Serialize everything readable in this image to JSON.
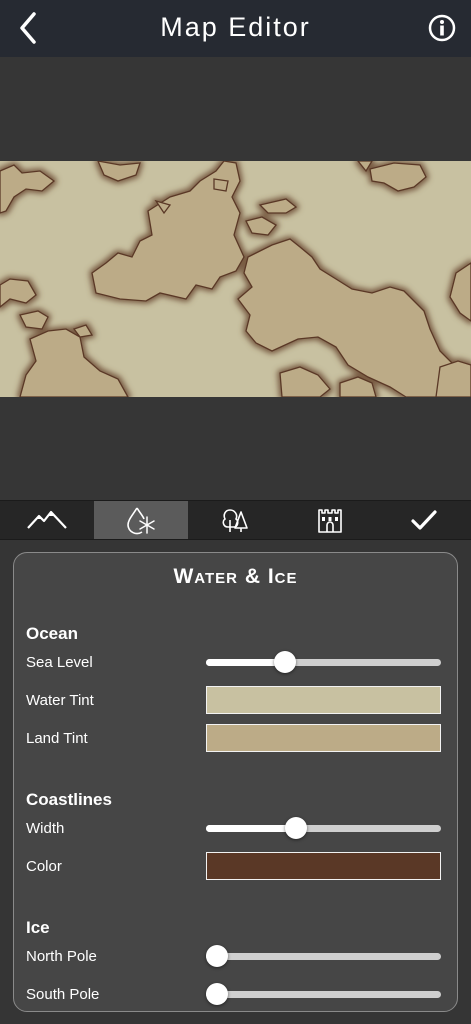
{
  "header": {
    "title": "Map Editor",
    "back_icon": "chevron-left",
    "info_icon": "info-circle"
  },
  "toolbar": {
    "tools": [
      {
        "name": "terrain",
        "icon": "mountains-icon",
        "active": false
      },
      {
        "name": "water-ice",
        "icon": "water-snowflake-icon",
        "active": true
      },
      {
        "name": "vegetation",
        "icon": "trees-icon",
        "active": false
      },
      {
        "name": "structures",
        "icon": "castle-icon",
        "active": false
      },
      {
        "name": "done",
        "icon": "checkmark-icon",
        "active": false
      }
    ]
  },
  "panel": {
    "title": "Water & Ice",
    "ocean": {
      "title": "Ocean",
      "sea_level_label": "Sea Level",
      "sea_level_value": 0.32,
      "water_tint_label": "Water Tint",
      "water_tint_color": "#c8c1a1",
      "land_tint_label": "Land Tint",
      "land_tint_color": "#bcab87"
    },
    "coastlines": {
      "title": "Coastlines",
      "width_label": "Width",
      "width_value": 0.37,
      "color_label": "Color",
      "color_value": "#5a3826"
    },
    "ice": {
      "title": "Ice",
      "north_pole_label": "North Pole",
      "north_pole_value": 0.0,
      "south_pole_label": "South Pole",
      "south_pole_value": 0.0
    }
  },
  "colors": {
    "header_bg": "#262a32",
    "map_water": "#c8c1a1",
    "map_land": "#bcab87",
    "map_coast": "#5a3826"
  }
}
